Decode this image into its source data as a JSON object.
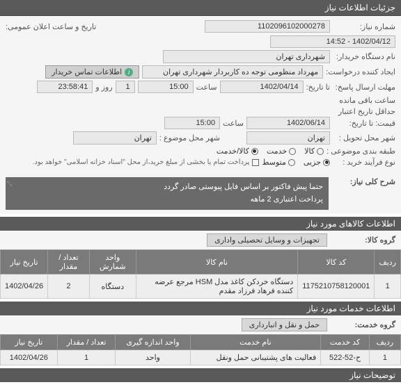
{
  "header": {
    "title": "جزئیات اطلاعات نیاز"
  },
  "form": {
    "need_no_label": "شماره نیاز:",
    "need_no": "1102096102000278",
    "send_time_label": "تاریخ و ساعت اعلان عمومی:",
    "send_time": "1402/04/12 - 14:52",
    "buyer_label": "نام دستگاه خریدار:",
    "buyer": "شهرداری تهران",
    "requester_label": "ایجاد کننده درخواست:",
    "requester": "مهرداد منظومی توجه ده کاربردار شهرداری تهران",
    "contact_btn": "اطلاعات تماس خریدار",
    "deadline_label": "مهلت ارسال پاسخ:",
    "deadline_to_label": "تا تاریخ:",
    "deadline_date": "1402/04/14",
    "time_label": "ساعت",
    "deadline_time": "15:00",
    "days_left_label": "روز و",
    "days_left": "1",
    "time_left": "23:58:41",
    "time_left_label": "ساعت باقی مانده",
    "validity_label": "حداقل تاریخ اعتبار",
    "validity_sub": "قیمت: تا تاریخ:",
    "validity_date": "1402/06/14",
    "validity_time": "15:00",
    "delivery_city_label": "شهر محل تحویل :",
    "delivery_city": "تهران",
    "subject_city_label": "شهر محل موضوع :",
    "subject_city": "تهران",
    "class_label": "طبقه بندی موضوعی :",
    "class_goods": "کالا",
    "class_service": "خدمت",
    "class_both": "کالا/خدمت",
    "process_label": "نوع فرآیند خرید :",
    "process_partial": "جزیی",
    "process_medium": "متوسط",
    "payment_note": "پرداخت تمام یا بخشی از مبلغ خرید،از محل \"اسناد خزانه اسلامی\" خواهد بود."
  },
  "desc": {
    "label": "شرح کلی نیاز:",
    "line1": "حتما پیش فاکتور بر اساس فایل پیوستی صادر گردد",
    "line2": "پرداخت اعتباری 2 ماهه"
  },
  "goods": {
    "section_title": "اطلاعات کالاهای مورد نیاز",
    "group_label": "گروه کالا:",
    "group_value": "تجهیزات و وسایل تحصیلی واداری",
    "headers": {
      "row": "ردیف",
      "code": "کد کالا",
      "name": "نام کالا",
      "unit": "واحد شمارش",
      "qty": "تعداد / مقدار",
      "date": "تاریخ نیاز"
    },
    "rows": [
      {
        "row": "1",
        "code": "1175210758120001",
        "name": "دستگاه خردکن کاغذ مدل HSM مرجع عرضه کننده فرهاد فرزاد مقدم",
        "unit": "دستگاه",
        "qty": "2",
        "date": "1402/04/26"
      }
    ]
  },
  "services": {
    "section_title": "اطلاعات خدمات مورد نیاز",
    "group_label": "گروه خدمت:",
    "group_value": "حمل و نقل و انبارداری",
    "headers": {
      "row": "ردیف",
      "code": "کد خدمت",
      "name": "نام خدمت",
      "unit": "واحد اندازه گیری",
      "qty": "تعداد / مقدار",
      "date": "تاریخ نیاز"
    },
    "rows": [
      {
        "row": "1",
        "code": "ح-52-522",
        "name": "فعالیت های پشتیبانی حمل ونقل",
        "unit": "واحد",
        "qty": "1",
        "date": "1402/04/26"
      }
    ]
  },
  "footer": {
    "section_title": "توضیحات نیاز"
  }
}
